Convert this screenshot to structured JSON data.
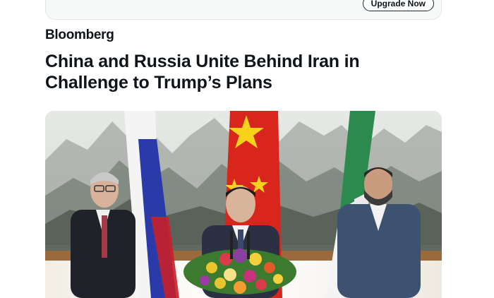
{
  "upgrade": {
    "button_label": "Upgrade Now"
  },
  "article": {
    "source": "Bloomberg",
    "headline": "China and Russia Unite Behind Iran in Challenge to Trump’s Plans"
  },
  "photo": {
    "icon": "news-photo"
  },
  "colors": {
    "text": "#0f1419",
    "card_bg": "#f7f9f9",
    "russia_white": "#f4f4f4",
    "russia_blue": "#2a3aa8",
    "russia_red": "#c8202a",
    "china_red": "#d9261c",
    "china_star": "#f6d21a",
    "iran_green": "#2d8a4e",
    "iran_red": "#c62a2a"
  }
}
